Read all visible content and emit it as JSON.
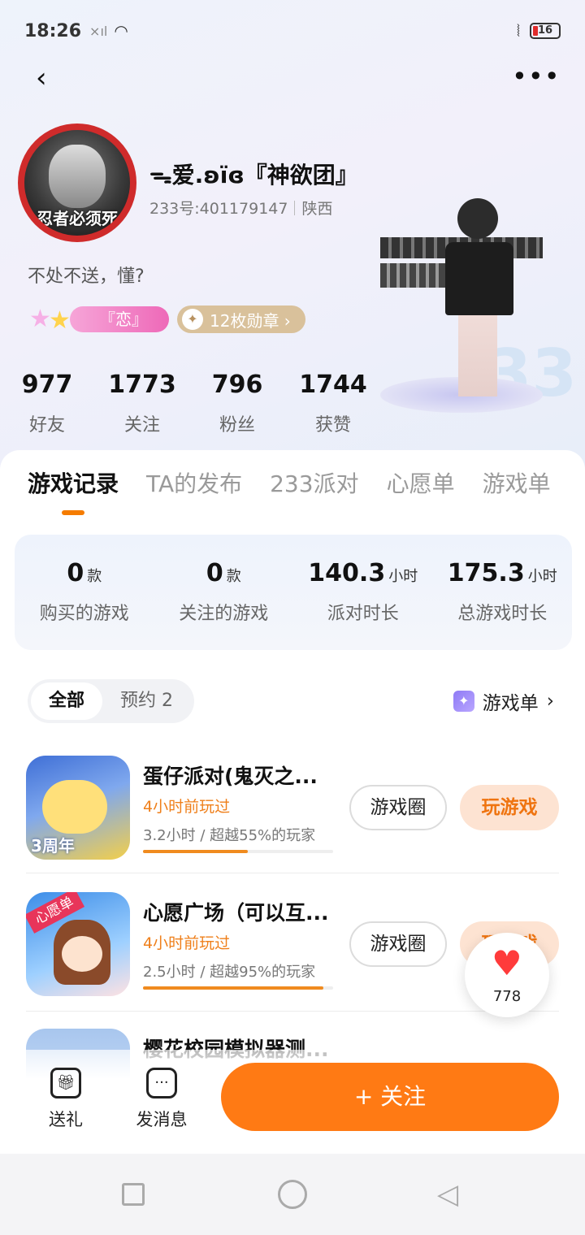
{
  "status_bar": {
    "time": "18:26",
    "signal": "×ıl",
    "wifi": "◠",
    "battery": "16"
  },
  "profile": {
    "nickname": "ᯓ爱.ʚïɞ『神欲团』",
    "uid": "233号:401179147",
    "region": "陕西",
    "signature": "不处不送，懂?",
    "tag_label": "『恋』",
    "medal_label": "12枚勋章 ›",
    "avatar_text": "忍者必须死"
  },
  "stats": [
    {
      "value": "977",
      "label": "好友"
    },
    {
      "value": "1773",
      "label": "关注"
    },
    {
      "value": "796",
      "label": "粉丝"
    },
    {
      "value": "1744",
      "label": "获赞"
    }
  ],
  "tabs": [
    "游戏记录",
    "TA的发布",
    "233派对",
    "心愿单",
    "游戏单"
  ],
  "summary": [
    {
      "value": "0",
      "unit": "款",
      "label": "购买的游戏"
    },
    {
      "value": "0",
      "unit": "款",
      "label": "关注的游戏"
    },
    {
      "value": "140.3",
      "unit": "小时",
      "label": "派对时长"
    },
    {
      "value": "175.3",
      "unit": "小时",
      "label": "总游戏时长"
    }
  ],
  "filters": {
    "all": "全部",
    "reserve": "预约 2",
    "gamelist": "游戏单"
  },
  "games": [
    {
      "name": "蛋仔派对(鬼灭之...",
      "when": "4小时前玩过",
      "stat": "3.2小时 / 超越55%的玩家",
      "progress": 0.55,
      "icon_text": "3周年",
      "btn_circle": "游戏圈",
      "btn_play": "玩游戏"
    },
    {
      "name": "心愿广场（可以互...",
      "when": "4小时前玩过",
      "stat": "2.5小时 / 超越95%的玩家",
      "progress": 0.95,
      "icon_text": "心愿单",
      "btn_circle": "游戏圈",
      "btn_play": "玩游戏"
    },
    {
      "name": "樱花校园模拟器测..."
    }
  ],
  "like": {
    "count": "778"
  },
  "bottom": {
    "gift": "送礼",
    "message": "发消息",
    "follow": "+ 关注"
  },
  "colors": {
    "accent": "#ff7a14",
    "tag_pink": "#ee69b8",
    "medal_gold": "#d9c19b"
  }
}
